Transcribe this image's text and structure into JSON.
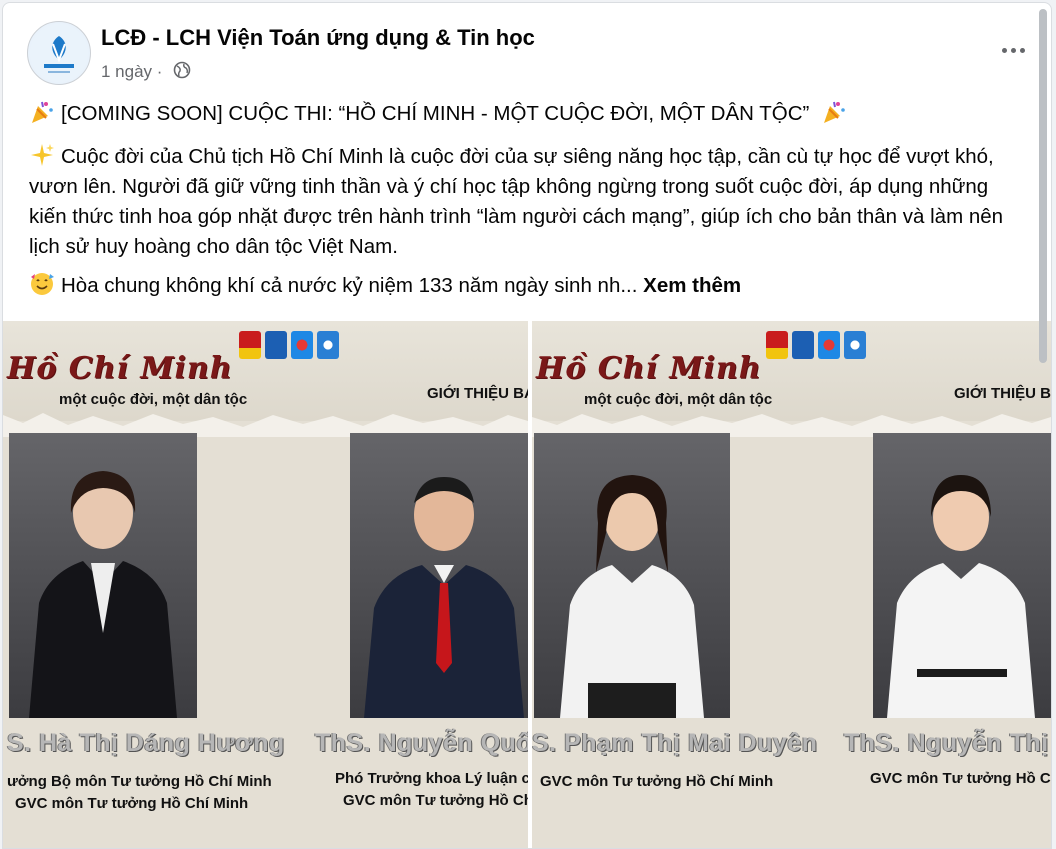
{
  "post": {
    "page_name": "LCĐ - LCH Viện Toán ứng dụng & Tin học",
    "time": "1 ngày",
    "dot": "·",
    "line1": "[COMING SOON] CUỘC THI: “HỒ CHÍ MINH - MỘT CUỘC ĐỜI, MỘT DÂN TỘC”",
    "paragraph": "Cuộc đời của Chủ tịch Hồ Chí Minh là cuộc đời của sự siêng năng học tập, cần cù tự học để vượt khó, vươn lên. Người đã giữ vững tinh thần và ý chí học tập không ngừng trong suốt cuộc đời, áp dụng những kiến thức tinh hoa góp nhặt được trên hành trình “làm người cách mạng”, giúp ích cho bản thân và làm nên lịch sử huy hoàng cho dân tộc Việt Nam.",
    "line3": "Hòa chung không khí cả nước kỷ niệm 133 năm ngày sinh nh...",
    "see_more": "Xem thêm"
  },
  "images": {
    "left": {
      "title": "Hồ Chí Minh",
      "subtitle": "một cuộc đời, một dân tộc",
      "intro": "GIỚI THIỆU BAN CỐ",
      "person1_name": "S. Hà Thị Dáng Hương",
      "person1_role1": "ưởng Bộ môn Tư tưởng Hồ Chí Minh",
      "person1_role2": "GVC môn Tư tưởng Hồ Chí Minh",
      "person2_name": "ThS. Nguyễn Quốc B",
      "person2_role1": "Phó Trưởng khoa Lý luận chính",
      "person2_role2": "GVC môn Tư tưởng Hồ Chí Mi"
    },
    "right": {
      "title": "Hồ Chí Minh",
      "subtitle": "một cuộc đời, một dân tộc",
      "intro": "GIỚI THIỆU BAN CỐ",
      "person1_name": "S. Phạm Thị Mai Duyên",
      "person1_role1": "GVC môn Tư tưởng Hồ Chí Minh",
      "person2_name": "ThS. Nguyễn Thị Thu",
      "person2_role1": "GVC môn Tư tưởng Hồ Chí Mi"
    }
  },
  "icons": {
    "more": "more-icon",
    "globe": "globe-icon",
    "party_popper": "party-popper-icon",
    "sparkles": "sparkles-icon",
    "smiling_face": "smiling-face-icon"
  }
}
